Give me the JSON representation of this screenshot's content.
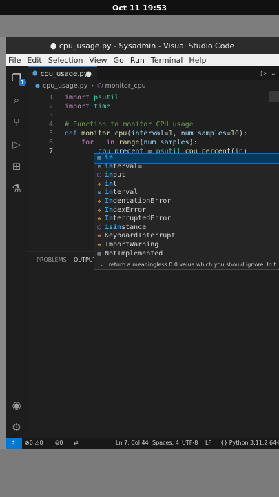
{
  "system": {
    "datetime": "Oct 11  19:53"
  },
  "window": {
    "title": "● cpu_usage.py - Sysadmin - Visual Studio Code"
  },
  "menu": [
    "File",
    "Edit",
    "Selection",
    "View",
    "Go",
    "Run",
    "Terminal",
    "Help"
  ],
  "activity": {
    "explorer_badge": "1"
  },
  "tab": {
    "label": "cpu_usage.py",
    "dirty": "●"
  },
  "breadcrumb": {
    "file": "cpu_usage.py",
    "symbol": "monitor_cpu"
  },
  "code_lines": [
    {
      "n": "1",
      "parts": [
        [
          "kw",
          "import"
        ],
        [
          "plain",
          " "
        ],
        [
          "mod",
          "psutil"
        ]
      ]
    },
    {
      "n": "2",
      "parts": [
        [
          "kw",
          "import"
        ],
        [
          "plain",
          " "
        ],
        [
          "mod",
          "time"
        ]
      ]
    },
    {
      "n": "3",
      "parts": []
    },
    {
      "n": "4",
      "parts": [
        [
          "cm",
          "# Function to monitor CPU usage"
        ]
      ]
    },
    {
      "n": "5",
      "parts": [
        [
          "bl",
          "def"
        ],
        [
          "plain",
          " "
        ],
        [
          "fn",
          "monitor_cpu"
        ],
        [
          "plain",
          "("
        ],
        [
          "var",
          "interval"
        ],
        [
          "plain",
          "="
        ],
        [
          "num",
          "1"
        ],
        [
          "plain",
          ", "
        ],
        [
          "var",
          "num_samples"
        ],
        [
          "plain",
          "="
        ],
        [
          "num",
          "10"
        ],
        [
          "plain",
          "):"
        ]
      ]
    },
    {
      "n": "6",
      "parts": [
        [
          "plain",
          "    "
        ],
        [
          "kw",
          "for"
        ],
        [
          "plain",
          " _ "
        ],
        [
          "kw",
          "in"
        ],
        [
          "plain",
          " "
        ],
        [
          "fn",
          "range"
        ],
        [
          "plain",
          "("
        ],
        [
          "var",
          "num_samples"
        ],
        [
          "plain",
          "):"
        ]
      ]
    },
    {
      "n": "7",
      "parts": [
        [
          "plain",
          "        "
        ],
        [
          "var",
          "cpu_precent"
        ],
        [
          "plain",
          " = "
        ],
        [
          "mod",
          "psutil"
        ],
        [
          "plain",
          "."
        ],
        [
          "fn",
          "cpu_percent"
        ],
        [
          "plain",
          "("
        ],
        [
          "var",
          "in"
        ],
        [
          "plain",
          ")"
        ]
      ]
    }
  ],
  "suggestions": [
    {
      "icon": "keyword-icon",
      "glyph": "▤",
      "cls": "kwi",
      "match": "in",
      "rest": "",
      "selected": true
    },
    {
      "icon": "variable-icon",
      "glyph": "⊡",
      "cls": "vari",
      "match": "in",
      "rest": "terval=",
      "selected": false
    },
    {
      "icon": "function-icon",
      "glyph": "⬡",
      "cls": "fni",
      "match": "in",
      "rest": "put",
      "selected": false
    },
    {
      "icon": "class-icon",
      "glyph": "✥",
      "cls": "cli",
      "match": "in",
      "rest": "t",
      "selected": false
    },
    {
      "icon": "variable-icon",
      "glyph": "⊡",
      "cls": "vari",
      "match": "in",
      "rest": "terval",
      "selected": false
    },
    {
      "icon": "class-icon",
      "glyph": "✥",
      "cls": "cli",
      "match": "In",
      "rest": "dentationError",
      "selected": false
    },
    {
      "icon": "class-icon",
      "glyph": "✥",
      "cls": "cli",
      "match": "In",
      "rest": "dexError",
      "selected": false
    },
    {
      "icon": "class-icon",
      "glyph": "✥",
      "cls": "cli",
      "match": "In",
      "rest": "terruptedError",
      "selected": false
    },
    {
      "icon": "function-icon",
      "glyph": "⬡",
      "cls": "fni",
      "match": "isin",
      "rest": "stance",
      "selected": false,
      "split": [
        "i",
        "s",
        "in",
        "stance"
      ]
    },
    {
      "icon": "class-icon",
      "glyph": "✥",
      "cls": "cli",
      "match": "",
      "rest": "KeyboardInterrupt",
      "selected": false
    },
    {
      "icon": "class-icon",
      "glyph": "✥",
      "cls": "cli",
      "match": "",
      "rest": "ImportWarning",
      "selected": false
    },
    {
      "icon": "keyword-icon",
      "glyph": "▤",
      "cls": "kwi",
      "match": "",
      "rest": "NotImplemented",
      "selected": false
    }
  ],
  "suggest_doc": "return a meaningless 0.0 value which you should ignore. In t",
  "panel": {
    "problems": "PROBLEMS",
    "output": "OUTPUT"
  },
  "status": {
    "errors": "0",
    "warnings": "0",
    "ports": "0",
    "position": "Ln 7, Col 44",
    "spaces": "Spaces: 4",
    "encoding": "UTF-8",
    "eol": "LF",
    "language": "Python",
    "interpreter": "3.11.2 64-b"
  }
}
